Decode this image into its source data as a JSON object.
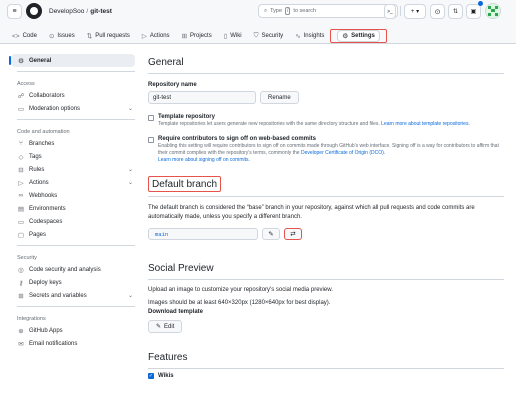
{
  "header": {
    "owner": "DevelopSoo",
    "separator": "/",
    "repo": "git-test",
    "search_placeholder": "Type",
    "search_key": "/",
    "search_suffix": "to search",
    "terminal_label": ">_",
    "plus_label": "+ ▾",
    "user_avatar_color": "#2da44e"
  },
  "tabs": [
    {
      "label": "Code",
      "icon": "<>"
    },
    {
      "label": "Issues",
      "icon": "⊙"
    },
    {
      "label": "Pull requests",
      "icon": "⇅"
    },
    {
      "label": "Actions",
      "icon": "▷"
    },
    {
      "label": "Projects",
      "icon": "⊞"
    },
    {
      "label": "Wiki",
      "icon": "▯"
    },
    {
      "label": "Security",
      "icon": "⛉"
    },
    {
      "label": "Insights",
      "icon": "∿"
    },
    {
      "label": "Settings",
      "icon": "⚙"
    }
  ],
  "sidebar": {
    "general": "General",
    "group_access": "Access",
    "collaborators": "Collaborators",
    "moderation": "Moderation options",
    "group_code": "Code and automation",
    "branches": "Branches",
    "tags": "Tags",
    "rules": "Rules",
    "actions": "Actions",
    "webhooks": "Webhooks",
    "environments": "Environments",
    "codespaces": "Codespaces",
    "pages": "Pages",
    "group_security": "Security",
    "code_security": "Code security and analysis",
    "deploy_keys": "Deploy keys",
    "secrets": "Secrets and variables",
    "group_integrations": "Integrations",
    "github_apps": "GitHub Apps",
    "email_notifications": "Email notifications"
  },
  "main": {
    "title": "General",
    "repo_name_label": "Repository name",
    "repo_name_value": "git-test",
    "rename_button": "Rename",
    "template_title": "Template repository",
    "template_desc": "Template repositories let users generate new repositories with the same directory structure and files.",
    "template_link": "Learn more about template repositories.",
    "signoff_title": "Require contributors to sign off on web-based commits",
    "signoff_desc": "Enabling this setting will require contributors to sign off on commits made through GitHub's web interface. Signing off is a way for contributors to affirm that their commit complies with the repository's terms, commonly the",
    "signoff_dco": "Developer Certificate of Origin (DCO).",
    "signoff_link": "Learn more about signing off on commits.",
    "default_branch_title": "Default branch",
    "default_branch_desc": "The default branch is considered the “base” branch in your repository, against which all pull requests and code commits are automatically made, unless you specify a different branch.",
    "default_branch_value": "main",
    "social_title": "Social Preview",
    "social_desc1": "Upload an image to customize your repository's social media preview.",
    "social_desc2": "Images should be at least 640×320px (1280×640px for best display).",
    "download_template": "Download template",
    "edit_button": "Edit",
    "features_title": "Features",
    "wikis_label": "Wikis"
  }
}
